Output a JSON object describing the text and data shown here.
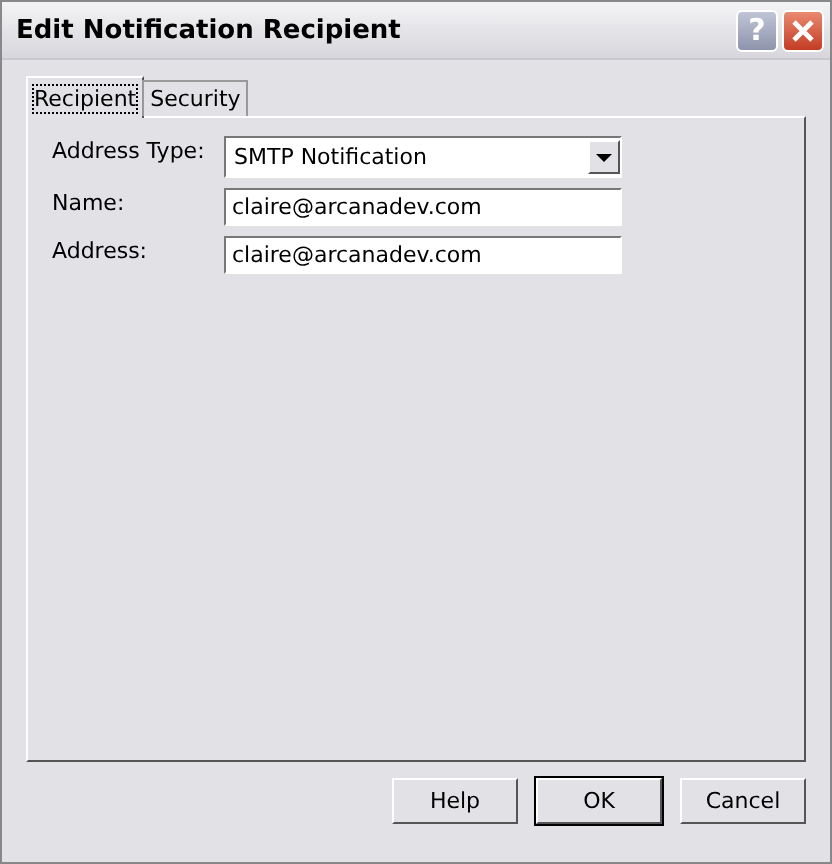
{
  "window": {
    "title": "Edit Notification Recipient",
    "help_button": "?"
  },
  "tabs": [
    {
      "label": "Recipient",
      "selected": true
    },
    {
      "label": "Security",
      "selected": false
    }
  ],
  "fields": [
    {
      "kind": "dropdown",
      "label": "Address Type:",
      "value": "SMTP Notification"
    },
    {
      "kind": "text",
      "label": "Name:",
      "value": "claire@arcanadev.com"
    },
    {
      "kind": "text",
      "label": "Address:",
      "value": "claire@arcanadev.com"
    }
  ],
  "buttons": [
    {
      "label": "Help",
      "default": false
    },
    {
      "label": "OK",
      "default": true
    },
    {
      "label": "Cancel",
      "default": false
    }
  ]
}
